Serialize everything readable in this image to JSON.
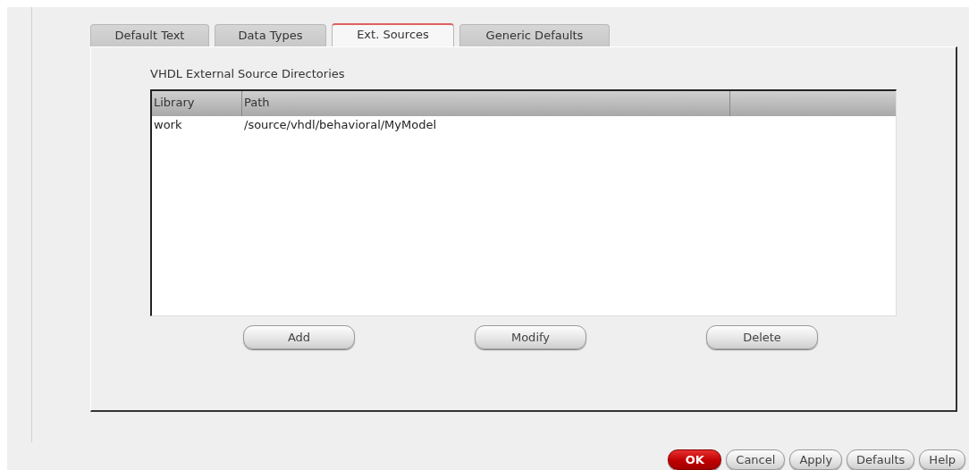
{
  "tabs": [
    {
      "label": "Default Text",
      "selected": false
    },
    {
      "label": "Data Types",
      "selected": false
    },
    {
      "label": "Ext. Sources",
      "selected": true
    },
    {
      "label": "Generic Defaults",
      "selected": false
    }
  ],
  "section_label": "VHDL External Source Directories",
  "table": {
    "columns": [
      "Library",
      "Path"
    ],
    "rows": [
      [
        "work",
        "/source/vhdl/behavioral/MyModel"
      ]
    ]
  },
  "table_buttons": [
    "Add",
    "Modify",
    "Delete"
  ],
  "dialog_buttons": [
    {
      "label": "OK",
      "kind": "default"
    },
    {
      "label": "Cancel",
      "kind": "normal"
    },
    {
      "label": "Apply",
      "kind": "normal"
    },
    {
      "label": "Defaults",
      "kind": "normal"
    },
    {
      "label": "Help",
      "kind": "normal"
    }
  ]
}
